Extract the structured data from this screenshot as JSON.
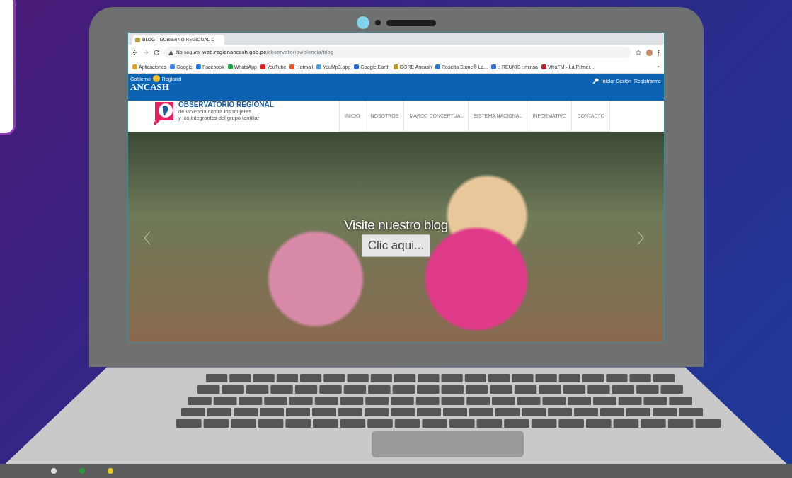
{
  "browser": {
    "tab_title": "BLOG - GOBIERNO REGIONAL D",
    "security": "No seguro",
    "url_host": "web.regionancash.gob.pe",
    "url_path": "/observatorioviolencia/blog",
    "bookmarks": [
      {
        "label": "Aplicaciones",
        "color": "#e8a020"
      },
      {
        "label": "Google",
        "color": "#4285f4"
      },
      {
        "label": "Facebook",
        "color": "#1877f2"
      },
      {
        "label": "WhatsApp",
        "color": "#25a244"
      },
      {
        "label": "YouTube",
        "color": "#e02020"
      },
      {
        "label": "Hotmail",
        "color": "#f25022"
      },
      {
        "label": "YouMp3.app",
        "color": "#4aa3e8"
      },
      {
        "label": "Google Earth",
        "color": "#2a6ad8"
      },
      {
        "label": "GORE Ancash",
        "color": "#b89a30"
      },
      {
        "label": "Rosetta Stone® La...",
        "color": "#2a7ad8"
      },
      {
        "label": ".: REUNIS :.minsa",
        "color": "#3a6ad0"
      },
      {
        "label": "VivaFM - La Primer...",
        "color": "#c02030"
      }
    ],
    "overflow": "»"
  },
  "site": {
    "logo_top_left": "Gobierno",
    "logo_top_right": "Regional",
    "logo_text": "ANCASH",
    "account_links": [
      "Iniciar Sesión",
      "Registrarme"
    ],
    "org_title": "OBSERVATORIO REGIONAL",
    "org_subtitle_lines": [
      "de violencia contra los mujeres",
      "y los integrontes del grupo familiar"
    ],
    "nav": [
      "INICIO",
      "NOSOTROS",
      "MARCO CONCEPTUAL",
      "SISTEMA NACIONAL",
      "INFORMATIVO",
      "CONTACTO"
    ],
    "hero": {
      "heading": "Visite nuestro blog",
      "button": "Clic aqui..."
    }
  }
}
